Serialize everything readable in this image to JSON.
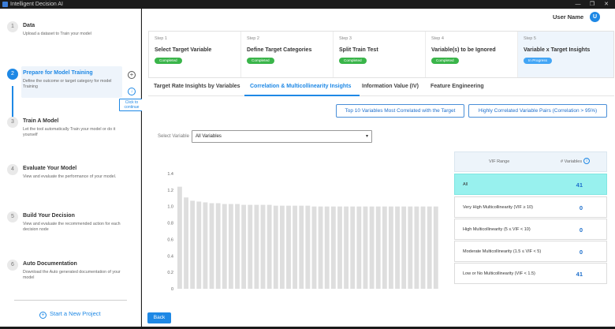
{
  "window": {
    "title": "Intelligent Decision AI",
    "controls": [
      "—",
      "❐",
      "✕"
    ]
  },
  "sidebar": {
    "steps": [
      {
        "num": "1",
        "title": "Data",
        "desc": "Upload a dataset to Train your model"
      },
      {
        "num": "2",
        "title": "Prepare for Model Training",
        "desc": "Define the outcome or target category for model Training"
      },
      {
        "num": "3",
        "title": "Train A Model",
        "desc": "Let the tool automatically Train your model or do it yourself"
      },
      {
        "num": "4",
        "title": "Evaluate Your Model",
        "desc": "View and evaluate the performance of your model."
      },
      {
        "num": "5",
        "title": "Build Your Decision",
        "desc": "View and evaluate the recommended action for each decision node"
      },
      {
        "num": "6",
        "title": "Auto Documentation",
        "desc": "Download the Auto generated documentation of your model"
      }
    ],
    "click_tip": "Click to continue",
    "new_project": "Start a New Project"
  },
  "header": {
    "user_name": "User Name",
    "avatar": "U"
  },
  "stepper": [
    {
      "label": "Step 1",
      "name": "Select Target Variable",
      "status": "Completed"
    },
    {
      "label": "Step 2",
      "name": "Define Target Categories",
      "status": "Completed"
    },
    {
      "label": "Step 3",
      "name": "Split Train Test",
      "status": "Completed"
    },
    {
      "label": "Step 4",
      "name": "Variable(s) to be Ignored",
      "status": "Completed"
    },
    {
      "label": "Step 5",
      "name": "Variable x Target Insights",
      "status": "In Progress"
    }
  ],
  "tabs": [
    {
      "label": "Target Rate Insights by Variables"
    },
    {
      "label": "Correlation & Multicollinearity Insights"
    },
    {
      "label": "Information Value (IV)"
    },
    {
      "label": "Feature Engineering"
    }
  ],
  "buttons": {
    "top10": "Top 10 Variables Most Correlated with the Target",
    "correlated_pairs": "Highly Correlated Variable Pairs (Correlation > 95%)",
    "back": "Back"
  },
  "select": {
    "label": "Select Variable",
    "value": "All Variables"
  },
  "vif_table": {
    "header_range": "VIF Range",
    "header_count": "# Variables",
    "rows": [
      {
        "label": "All",
        "value": "41"
      },
      {
        "label": "Very High Multicollinearity (VIF ≥ 10)",
        "value": "0"
      },
      {
        "label": "High Multicollinearity (5 ≤ VIF < 10)",
        "value": "0"
      },
      {
        "label": "Moderate Multicollinearity (1.5 ≤ VIF < 5)",
        "value": "0"
      },
      {
        "label": "Low or No Multicollinearity (VIF < 1.5)",
        "value": "41"
      }
    ]
  },
  "chart_data": {
    "type": "bar",
    "ylim": [
      0,
      1.4
    ],
    "yticks": [
      "0",
      "0.2",
      "0.4",
      "0.6",
      "0.8",
      "1.0",
      "1.2",
      "1.4"
    ],
    "values": [
      1.24,
      1.11,
      1.07,
      1.06,
      1.05,
      1.04,
      1.04,
      1.03,
      1.03,
      1.03,
      1.02,
      1.02,
      1.02,
      1.02,
      1.02,
      1.01,
      1.01,
      1.01,
      1.01,
      1.01,
      1.01,
      1.0,
      1.0,
      1.0,
      1.0,
      1.0,
      1.0,
      1.0,
      1.0,
      1.0,
      1.0,
      1.0,
      1.0,
      1.0,
      1.0,
      1.0,
      1.0,
      1.0,
      1.0,
      1.0,
      1.0
    ],
    "bar_color": "#dedede"
  }
}
